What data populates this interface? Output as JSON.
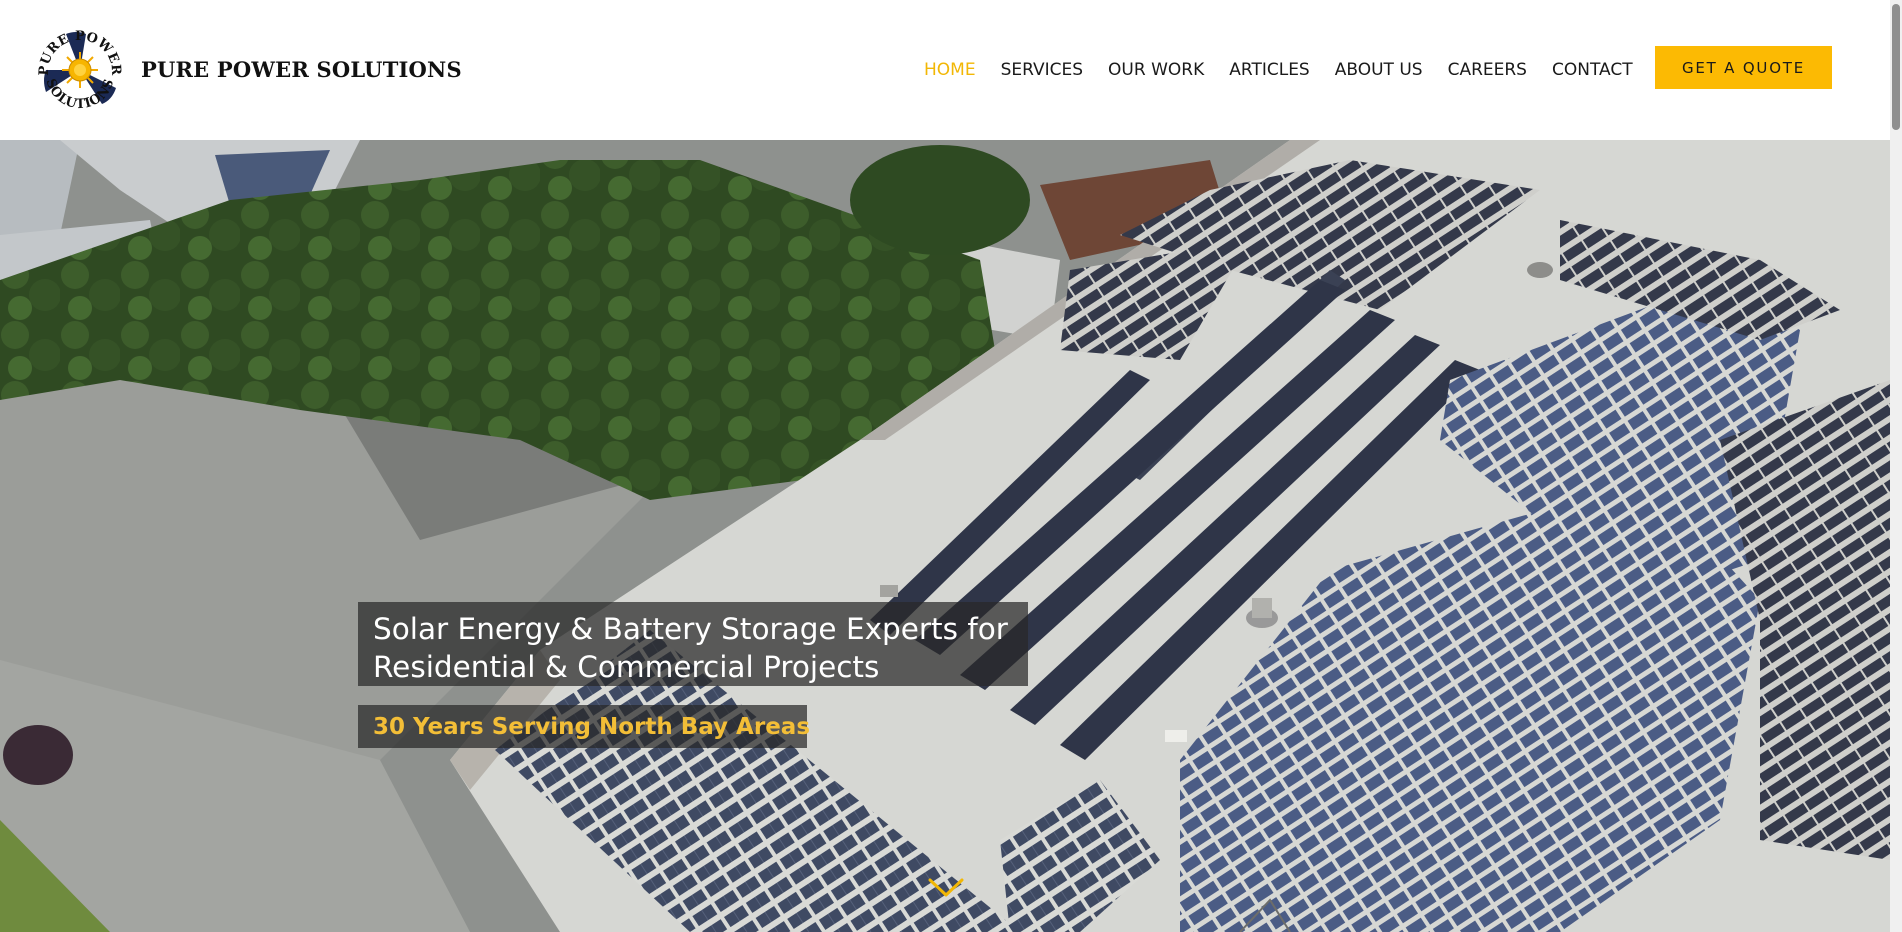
{
  "brand": {
    "name": "PURE POWER SOLUTIONS",
    "logo_text_top": "PURE POWER",
    "logo_text_bottom": "SOLUTIONS"
  },
  "nav": {
    "items": [
      {
        "label": "HOME",
        "active": true
      },
      {
        "label": "SERVICES",
        "active": false
      },
      {
        "label": "OUR WORK",
        "active": false
      },
      {
        "label": "ARTICLES",
        "active": false
      },
      {
        "label": "ABOUT US",
        "active": false
      },
      {
        "label": "CAREERS",
        "active": false
      },
      {
        "label": "CONTACT",
        "active": false
      }
    ],
    "cta_label": "GET A QUOTE"
  },
  "hero": {
    "headline_line1": "Solar Energy & Battery Storage Experts for",
    "headline_line2": "Residential & Commercial Projects",
    "tagline": "30 Years Serving North Bay Areas",
    "scroll_icon": "chevron-down-icon"
  },
  "colors": {
    "accent": "#fcba03",
    "active_nav": "#f2b705",
    "tagline": "#f3be37",
    "overlay": "rgba(40,40,40,0.72)"
  }
}
